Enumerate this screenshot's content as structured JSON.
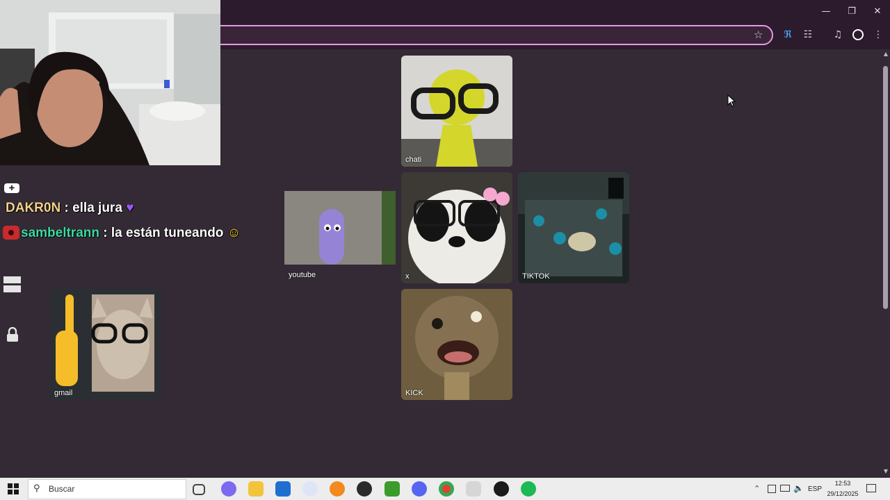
{
  "chat": [
    {
      "user": "DAKR0N",
      "sep": " : ",
      "message": "ella jura",
      "user_color": "#f3d28d"
    },
    {
      "user": "sambeltrann",
      "sep": " : ",
      "message": "la están tuneando",
      "user_color": "#3fd9a4"
    }
  ],
  "tiles": [
    {
      "label": "chati"
    },
    {
      "label": "youtube"
    },
    {
      "label": "x"
    },
    {
      "label": "TIKTOK"
    },
    {
      "label": "gmail"
    },
    {
      "label": "KICK"
    }
  ],
  "taskbar": {
    "search_label": "Buscar",
    "language": "ESP",
    "time": "12:53",
    "date": "29/12/2025"
  },
  "icons": {
    "window": [
      "minimize-icon",
      "restore-icon",
      "close-icon"
    ],
    "toolbar": [
      "star-icon",
      "translate-extension-icon",
      "extensions-icon",
      "media-control-icon",
      "profile-icon",
      "menu-icon"
    ],
    "left": [
      "game-controller-icon",
      "widget-icon",
      "lock-icon"
    ],
    "taskbar": [
      "windows-start-icon",
      "search-icon",
      "task-view-icon",
      "copilot-icon",
      "file-explorer-icon",
      "microsoft-store-icon",
      "word-icon",
      "app-icon",
      "obs-icon",
      "minecraft-icon",
      "discord-icon",
      "chrome-icon",
      "chrome-profile-icon",
      "roblox-icon",
      "spotify-icon"
    ],
    "tray": [
      "show-hidden-icons-icon",
      "battery-icon",
      "network-icon",
      "volume-icon",
      "notifications-icon"
    ]
  },
  "colors": {
    "page_bg": "#332a35",
    "chrome_bg": "#2c1b2c",
    "omnibox_border": "#e39ae6",
    "taskbar_bg": "#ededed"
  }
}
